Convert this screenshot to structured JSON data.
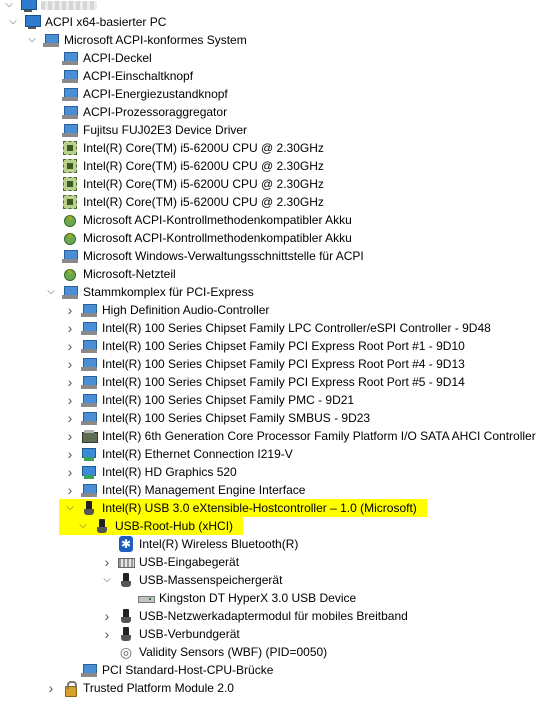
{
  "root": {
    "computer_name_redacted": true
  },
  "nodes": [
    {
      "label": "ACPI x64-basierter PC",
      "icon": "computer-icon",
      "level": 1,
      "toggle": "expanded"
    },
    {
      "label": "Microsoft ACPI-konformes System",
      "icon": "system-device-icon",
      "level": 2,
      "toggle": "expanded"
    },
    {
      "label": "ACPI-Deckel",
      "icon": "system-device-icon",
      "level": 3,
      "toggle": "none"
    },
    {
      "label": "ACPI-Einschaltknopf",
      "icon": "system-device-icon",
      "level": 3,
      "toggle": "none"
    },
    {
      "label": "ACPI-Energiezustandknopf",
      "icon": "system-device-icon",
      "level": 3,
      "toggle": "none"
    },
    {
      "label": "ACPI-Prozessoraggregator",
      "icon": "system-device-icon",
      "level": 3,
      "toggle": "none"
    },
    {
      "label": "Fujitsu FUJ02E3 Device Driver",
      "icon": "system-device-icon",
      "level": 3,
      "toggle": "none"
    },
    {
      "label": "Intel(R) Core(TM) i5-6200U CPU @ 2.30GHz",
      "icon": "processor-icon",
      "level": 3,
      "toggle": "none"
    },
    {
      "label": "Intel(R) Core(TM) i5-6200U CPU @ 2.30GHz",
      "icon": "processor-icon",
      "level": 3,
      "toggle": "none"
    },
    {
      "label": "Intel(R) Core(TM) i5-6200U CPU @ 2.30GHz",
      "icon": "processor-icon",
      "level": 3,
      "toggle": "none"
    },
    {
      "label": "Intel(R) Core(TM) i5-6200U CPU @ 2.30GHz",
      "icon": "processor-icon",
      "level": 3,
      "toggle": "none"
    },
    {
      "label": "Microsoft ACPI-Kontrollmethodenkompatibler Akku",
      "icon": "battery-icon",
      "level": 3,
      "toggle": "none"
    },
    {
      "label": "Microsoft ACPI-Kontrollmethodenkompatibler Akku",
      "icon": "battery-icon",
      "level": 3,
      "toggle": "none"
    },
    {
      "label": "Microsoft Windows-Verwaltungsschnittstelle für ACPI",
      "icon": "system-device-icon",
      "level": 3,
      "toggle": "none"
    },
    {
      "label": "Microsoft-Netzteil",
      "icon": "battery-icon",
      "level": 3,
      "toggle": "none"
    },
    {
      "label": "Stammkomplex für PCI-Express",
      "icon": "system-device-icon",
      "level": 3,
      "toggle": "expanded"
    },
    {
      "label": "High Definition Audio-Controller",
      "icon": "system-device-icon",
      "level": 4,
      "toggle": "collapsed"
    },
    {
      "label": "Intel(R) 100 Series Chipset Family LPC Controller/eSPI Controller - 9D48",
      "icon": "system-device-icon",
      "level": 4,
      "toggle": "collapsed"
    },
    {
      "label": "Intel(R) 100 Series Chipset Family PCI Express Root Port #1 - 9D10",
      "icon": "system-device-icon",
      "level": 4,
      "toggle": "collapsed"
    },
    {
      "label": "Intel(R) 100 Series Chipset Family PCI Express Root Port #4 - 9D13",
      "icon": "system-device-icon",
      "level": 4,
      "toggle": "collapsed"
    },
    {
      "label": "Intel(R) 100 Series Chipset Family PCI Express Root Port #5 - 9D14",
      "icon": "system-device-icon",
      "level": 4,
      "toggle": "collapsed"
    },
    {
      "label": "Intel(R) 100 Series Chipset Family PMC - 9D21",
      "icon": "system-device-icon",
      "level": 4,
      "toggle": "collapsed"
    },
    {
      "label": "Intel(R) 100 Series Chipset Family SMBUS - 9D23",
      "icon": "system-device-icon",
      "level": 4,
      "toggle": "collapsed"
    },
    {
      "label": "Intel(R) 6th Generation Core Processor Family Platform I/O SATA AHCI Controller",
      "icon": "storage-controller-icon",
      "level": 4,
      "toggle": "collapsed"
    },
    {
      "label": "Intel(R) Ethernet Connection I219-V",
      "icon": "network-adapter-icon",
      "level": 4,
      "toggle": "collapsed"
    },
    {
      "label": "Intel(R) HD Graphics 520",
      "icon": "display-adapter-icon",
      "level": 4,
      "toggle": "collapsed"
    },
    {
      "label": "Intel(R) Management Engine Interface",
      "icon": "system-device-icon",
      "level": 4,
      "toggle": "collapsed"
    },
    {
      "label": "Intel(R) USB 3.0 eXtensible-Hostcontroller – 1.0 (Microsoft)",
      "icon": "usb-icon",
      "level": 4,
      "toggle": "expanded",
      "highlight": true
    },
    {
      "label": "USB-Root-Hub (xHCI)",
      "icon": "usb-icon",
      "level": 5,
      "toggle": "expanded",
      "highlight": true
    },
    {
      "label": "Intel(R) Wireless Bluetooth(R)",
      "icon": "bluetooth-icon",
      "level": 6,
      "toggle": "none"
    },
    {
      "label": "USB-Eingabegerät",
      "icon": "keyboard-icon",
      "level": 6,
      "toggle": "collapsed"
    },
    {
      "label": "USB-Massenspeichergerät",
      "icon": "usb-icon",
      "level": 6,
      "toggle": "expanded"
    },
    {
      "label": "Kingston DT HyperX 3.0 USB Device",
      "icon": "disk-drive-icon",
      "level": 7,
      "toggle": "none"
    },
    {
      "label": "USB-Netzwerkadaptermodul für mobiles Breitband",
      "icon": "usb-icon",
      "level": 6,
      "toggle": "collapsed"
    },
    {
      "label": "USB-Verbundgerät",
      "icon": "usb-icon",
      "level": 6,
      "toggle": "collapsed"
    },
    {
      "label": "Validity Sensors (WBF) (PID=0050)",
      "icon": "fingerprint-icon",
      "level": 6,
      "toggle": "none"
    },
    {
      "label": "PCI Standard-Host-CPU-Brücke",
      "icon": "system-device-icon",
      "level": 4,
      "toggle": "none"
    },
    {
      "label": "Trusted Platform Module 2.0",
      "icon": "tpm-icon",
      "level": 3,
      "toggle": "collapsed"
    }
  ],
  "colors": {
    "highlight": "#ffff00",
    "background": "#ffffff"
  }
}
